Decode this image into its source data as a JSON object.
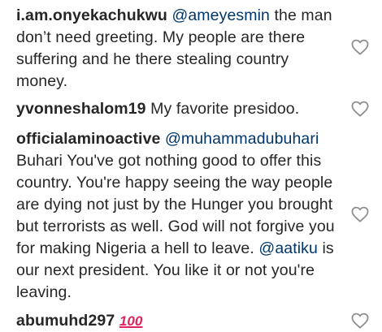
{
  "comments": [
    {
      "username": "i.am.onyekachukwu",
      "mention": "@ameyesmin",
      "text_after_mention": " the man don’t need greeting. My people are there suffering and he there stealing country money."
    },
    {
      "username": "yvonneshalom19",
      "text": " My favorite presidoo."
    },
    {
      "username": "officialaminoactive",
      "mention": "@muhammadubuhari",
      "text_after_mention": " Buhari You've got nothing good to offer this country. You're happy seeing the way people are dying not just by the Hunger you brought but terrorists as well. God will not forgive you for making Nigeria a hell to leave. ",
      "mention2": "@aatiku",
      "text_after_mention2": " is our next president. You like it or not you're leaving."
    },
    {
      "username": "abumuhd297",
      "emoji": "100",
      "emoji_name": "hundred-points-emoji"
    }
  ],
  "icons": {
    "like": "heart-outline-icon"
  },
  "colors": {
    "text": "#262626",
    "mention": "#003569",
    "heart_stroke": "#8e8e8e",
    "emoji_red": "#e0245e"
  }
}
